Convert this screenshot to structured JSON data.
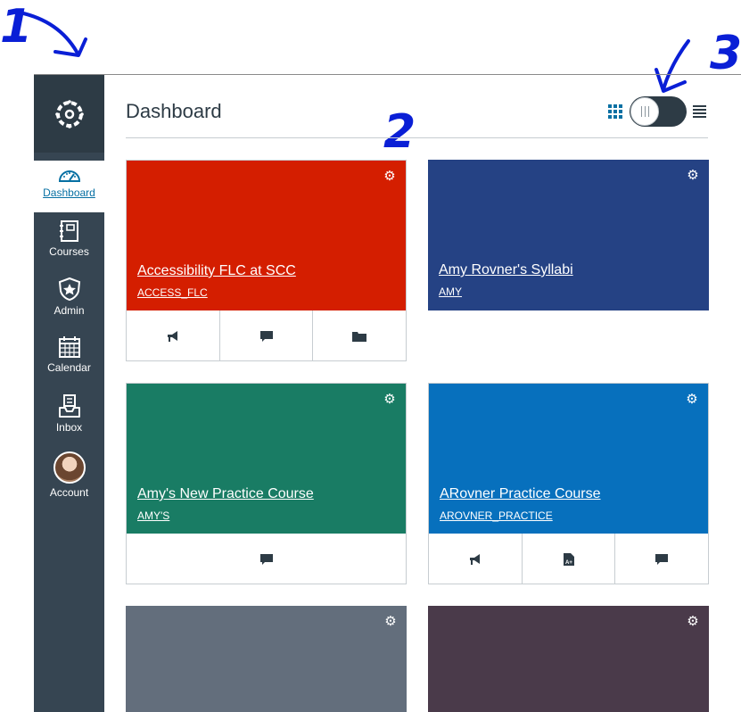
{
  "annotations": {
    "one": "1",
    "two": "2",
    "three": "3"
  },
  "sidebar": {
    "items": [
      {
        "label": "Dashboard",
        "icon": "dashboard-icon",
        "active": true
      },
      {
        "label": "Courses",
        "icon": "courses-icon"
      },
      {
        "label": "Admin",
        "icon": "admin-icon"
      },
      {
        "label": "Calendar",
        "icon": "calendar-icon"
      },
      {
        "label": "Inbox",
        "icon": "inbox-icon"
      },
      {
        "label": "Account",
        "icon": "avatar"
      }
    ]
  },
  "header": {
    "title": "Dashboard",
    "view_toggle": "list-view"
  },
  "cards": [
    {
      "title": "Accessibility FLC at SCC",
      "code": "ACCESS_FLC",
      "color": "#d41e00",
      "actions": [
        "announcements-icon",
        "discussions-icon",
        "files-icon"
      ]
    },
    {
      "title": "Amy Rovner's Syllabi",
      "code": "AMY",
      "color": "#254284",
      "actions": []
    },
    {
      "title": "Amy's New Practice Course",
      "code": "AMY'S",
      "color": "#197c64",
      "actions": [
        "discussions-icon"
      ]
    },
    {
      "title": "ARovner Practice Course",
      "code": "AROVNER_PRACTICE",
      "color": "#0770bd",
      "actions": [
        "announcements-icon",
        "assignments-icon",
        "discussions-icon"
      ]
    },
    {
      "title": "",
      "code": "",
      "color": "#636e7c",
      "actions": []
    },
    {
      "title": "",
      "code": "",
      "color": "#4a3a4a",
      "actions": []
    }
  ],
  "colors": {
    "sidebar": "#364552",
    "logo_bg": "#2d3b45",
    "accent": "#0770a3",
    "annotation": "#0a1fd6"
  }
}
